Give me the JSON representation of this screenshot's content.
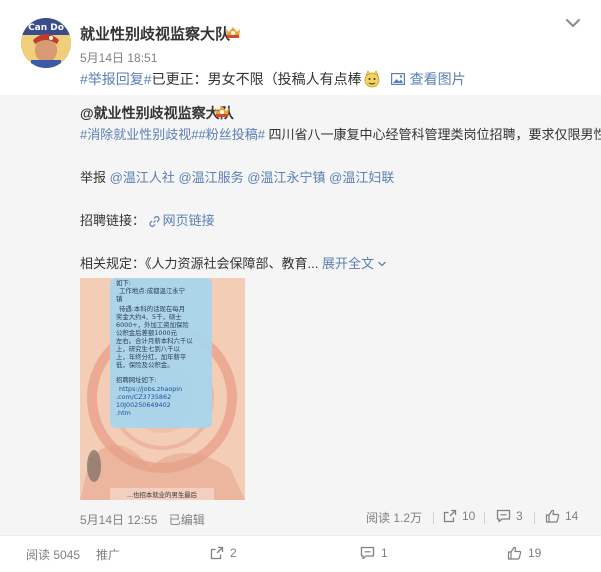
{
  "header": {
    "account_name": "就业性别歧视监察大队",
    "post_time": "5月14日 18:51",
    "topic": "#举报回复#",
    "text": " 已更正：男女不限（投稿人有点棒",
    "view_picture": "查看图片",
    "avatar_label": "Can Do"
  },
  "quote": {
    "author": "@就业性别歧视监察大队",
    "topics": "#消除就业性别歧视##粉丝投稿#",
    "body": " 四川省八一康复中心经管科管理类岗位招聘，要求仅限男性。",
    "report_label": "举报",
    "report_mentions": [
      "@温江人社",
      "@温江服务",
      "@温江永宁镇",
      "@温江妇联"
    ],
    "recruit_label": "招聘链接：",
    "recruit_link": "网页链接",
    "related_label": "相关规定：《人力资源社会保障部、教育...",
    "expand_label": "展开全文",
    "image_text": [
      "如下:",
      "工作地点:成都温江永宁",
      "镇",
      "待遇:本科的话现在每月",
      "奖金大约4、5千，硕士",
      "6000+，外加工资加保险",
      "公积金后差额1000元",
      "左右。合计月薪本科六千以",
      "上，研究生七到八千以",
      "上，年终分红，加年薪平",
      "低，保险及公积金。",
      "招聘网址如下:",
      "https://jobs.zhaopin",
      ".com/CZ3735862",
      "10J00250649402",
      ".htm"
    ],
    "image_caption": "...也招本就业的男生最后",
    "meta_time": "5月14日 12:55",
    "meta_status": "已编辑",
    "reads": "阅读 1.2万",
    "reposts": "10",
    "comments": "3",
    "likes": "14"
  },
  "footer": {
    "reads": "阅读 5045",
    "promote": "推广",
    "reposts": "2",
    "comments": "1",
    "likes": "19"
  },
  "colors": {
    "link": "#5b7fb4",
    "muted": "#808080",
    "card_bg": "#f5f5f5",
    "badge": "#e8a634"
  }
}
